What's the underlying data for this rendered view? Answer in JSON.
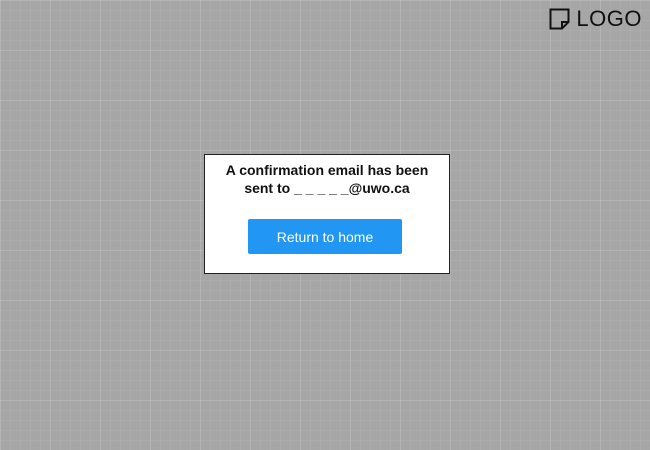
{
  "logo": {
    "icon": "note-icon",
    "text": "LOGO"
  },
  "dialog": {
    "message_line1": "A confirmation email has been",
    "message_line2": "sent to _ _ _ _ _@uwo.ca",
    "button_label": "Return to home"
  },
  "colors": {
    "background": "#a6a6a6",
    "button": "#2196f3",
    "button_text": "#ffffff",
    "dialog_border": "#222222"
  }
}
